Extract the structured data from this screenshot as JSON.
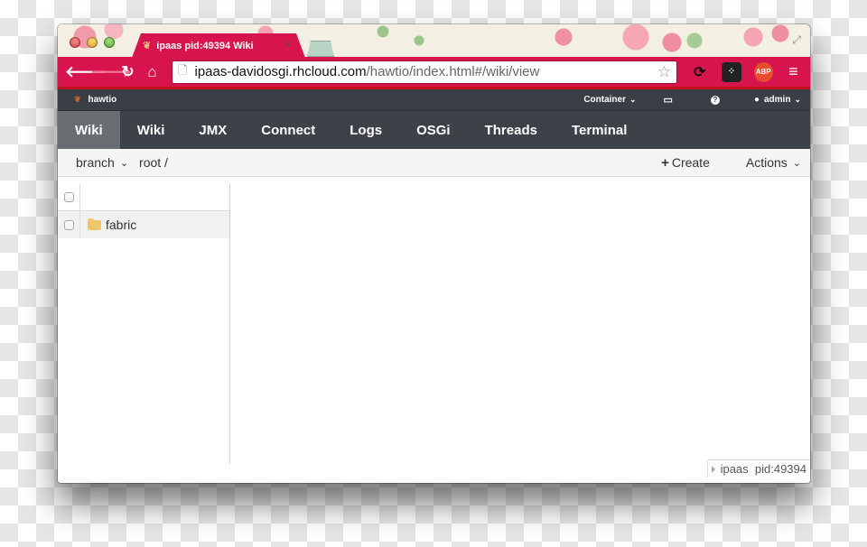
{
  "browser": {
    "tab_title": "ipaas pid:49394 Wiki",
    "tab_favicon": "hawtio-icon",
    "tab_close": "×",
    "url_host": "ipaas-davidosgi.rhcloud.com",
    "url_path": "/hawtio/index.html#/wiki/view",
    "nav": {
      "back": "🡐",
      "forward": "🡒",
      "reload": "↻",
      "home": "⌂"
    },
    "icons": {
      "page": "🗋",
      "star": "☆",
      "sync": "⟳",
      "blackberry": "⁘",
      "abp": "ABP",
      "menu": "≡",
      "fullscreen": "⤢"
    }
  },
  "hawtio": {
    "brand": "hawtio",
    "container_label": "Container",
    "admin_label": "admin",
    "help_glyph": "?",
    "monitor_glyph": "▭",
    "user_glyph": "👤",
    "chevron": "⌄",
    "main_nav": [
      {
        "label": "Wiki",
        "active": true
      },
      {
        "label": "Wiki",
        "active": false
      },
      {
        "label": "JMX",
        "active": false
      },
      {
        "label": "Connect",
        "active": false
      },
      {
        "label": "Logs",
        "active": false
      },
      {
        "label": "OSGi",
        "active": false
      },
      {
        "label": "Threads",
        "active": false
      },
      {
        "label": "Terminal",
        "active": false
      }
    ],
    "subbar": {
      "branch_label": "branch",
      "root_label": "root /",
      "create_label": "Create",
      "plus_glyph": "+",
      "actions_label": "Actions"
    },
    "tree": {
      "items": [
        {
          "label": "fabric",
          "type": "folder"
        }
      ]
    },
    "footer": "ipaas  pid:49394"
  },
  "colors": {
    "browser_accent": "#d8144f",
    "hawtio_header": "#393f44",
    "nav_bg": "#3d4248",
    "nav_active": "#6a6e73",
    "folder": "#f0c66c"
  }
}
